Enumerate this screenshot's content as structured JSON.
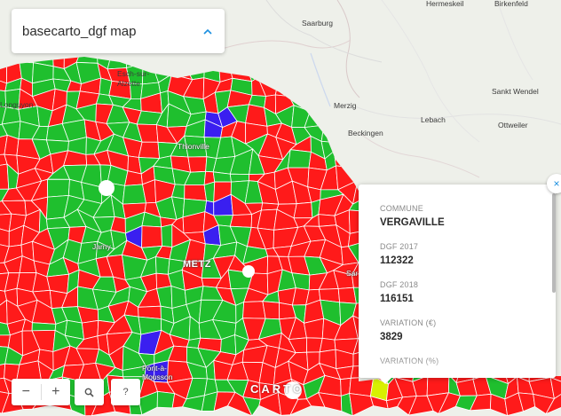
{
  "title_panel": {
    "title": "basecarto_dgf map",
    "icon": "chevron-up-icon"
  },
  "places": [
    {
      "name": "Hermeskeil",
      "style": "dark"
    },
    {
      "name": "Birkenfeld",
      "style": "dark"
    },
    {
      "name": "Saarburg",
      "style": "dark"
    },
    {
      "name": "Esch-sur-Alzette",
      "style": "dark"
    },
    {
      "name": "Longuyon",
      "style": "dark"
    },
    {
      "name": "Merzig",
      "style": "dark"
    },
    {
      "name": "Sankt Wendel",
      "style": "dark"
    },
    {
      "name": "Lebach",
      "style": "dark"
    },
    {
      "name": "Ottweiler",
      "style": "dark"
    },
    {
      "name": "Beckingen",
      "style": "dark"
    },
    {
      "name": "Thionville",
      "style": "on-choro"
    },
    {
      "name": "Jarny",
      "style": "on-choro"
    },
    {
      "name": "METZ",
      "style": "metz"
    },
    {
      "name": "Sar",
      "style": "on-choro"
    },
    {
      "name": "Pont-à-Mousson",
      "style": "on-choro"
    }
  ],
  "popup": {
    "fields": [
      {
        "label": "COMMUNE",
        "value": "VERGAVILLE"
      },
      {
        "label": "DGF 2017",
        "value": "112322"
      },
      {
        "label": "DGF 2018",
        "value": "116151"
      },
      {
        "label": "VARIATION (€)",
        "value": "3829"
      },
      {
        "label": "VARIATION (%)",
        "value": ""
      }
    ],
    "close_label": "×"
  },
  "controls": {
    "zoom_out_label": "−",
    "zoom_in_label": "+",
    "search_icon": "search-icon",
    "help_label": "?"
  },
  "attribution": {
    "logo_text": "CARTO"
  },
  "colors": {
    "decrease": "#ff1a1a",
    "increase": "#1fbf2e",
    "highlight": "#3a1ff0",
    "selected": "#d8f000",
    "basemap": "#eef0ea",
    "border": "#ffffff"
  }
}
